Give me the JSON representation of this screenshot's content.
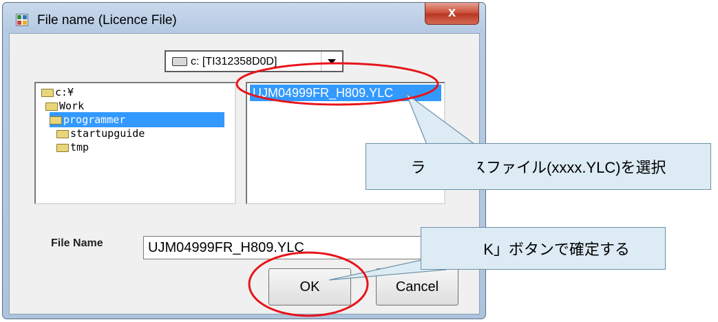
{
  "window": {
    "title": "File name (Licence File)",
    "close_label": "x"
  },
  "drive": {
    "label": "c: [TI312358D0D]"
  },
  "directories": [
    {
      "label": "c:¥",
      "selected": false
    },
    {
      "label": "Work",
      "selected": false
    },
    {
      "label": "programmer",
      "selected": true
    },
    {
      "label": "startupguide",
      "selected": false
    },
    {
      "label": "tmp",
      "selected": false
    }
  ],
  "files": [
    {
      "label": "UJM04999FR_H809.YLC",
      "selected": true
    }
  ],
  "file_name": {
    "label": "File Name",
    "value": "UJM04999FR_H809.YLC"
  },
  "buttons": {
    "ok": "OK",
    "cancel": "Cancel"
  },
  "annotations": {
    "select_file": "ライセンスファイル(xxxx.YLC)を選択",
    "confirm_ok": "「OK」ボタンで確定する",
    "highlight_color": "#e8131a",
    "callout_color": "#dcebf4"
  }
}
